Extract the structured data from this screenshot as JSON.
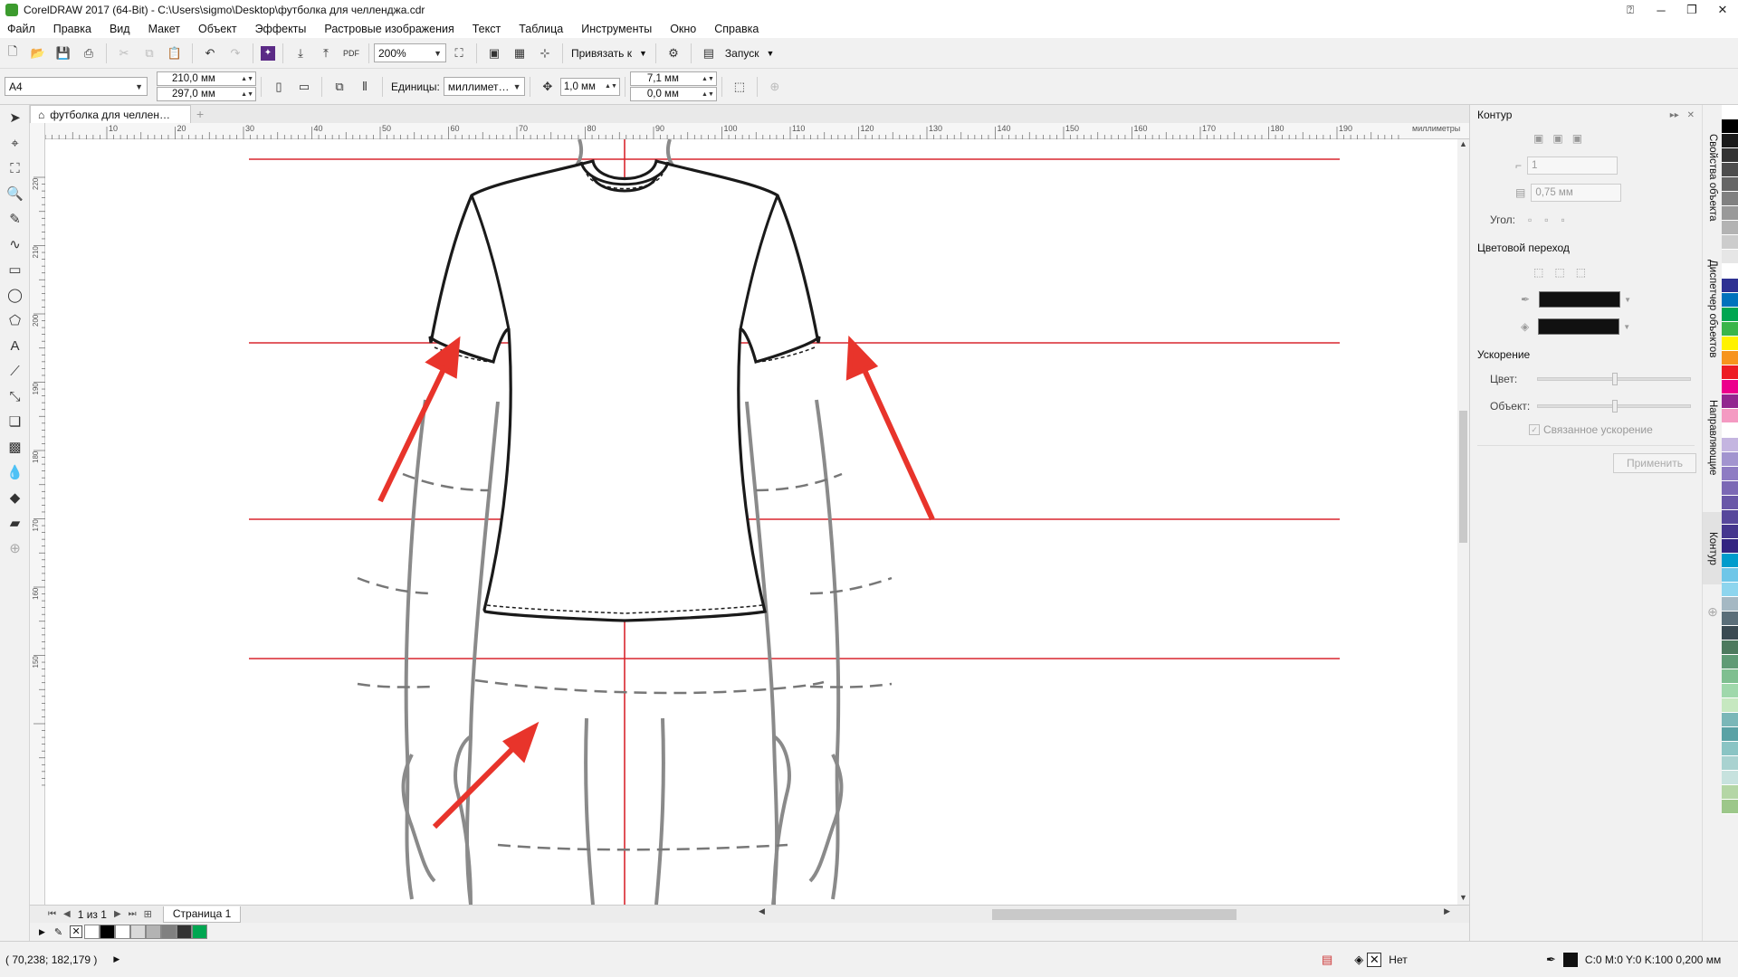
{
  "app": {
    "title": "CorelDRAW 2017 (64-Bit) - C:\\Users\\sigmo\\Desktop\\футболка для челленджа.cdr",
    "accent": "#3c9b2e"
  },
  "menu": [
    "Файл",
    "Правка",
    "Вид",
    "Макет",
    "Объект",
    "Эффекты",
    "Растровые изображения",
    "Текст",
    "Таблица",
    "Инструменты",
    "Окно",
    "Справка"
  ],
  "toolbar": {
    "zoom": "200%",
    "snap_label": "Привязать к",
    "launch_label": "Запуск",
    "pdf_label": "PDF"
  },
  "propbar": {
    "page_size": "A4",
    "width": "210,0 мм",
    "height": "297,0 мм",
    "units_label": "Единицы:",
    "units_value": "миллимет…",
    "nudge": "1,0 мм",
    "dup_x": "7,1 мм",
    "dup_y": "0,0 мм"
  },
  "doc_tab": "футболка для челлен…",
  "ruler": {
    "unit": "миллиметры",
    "h_ticks": [
      "10",
      "20",
      "30",
      "40",
      "50",
      "60",
      "70",
      "80",
      "90",
      "100",
      "110",
      "120",
      "130",
      "140",
      "150",
      "160",
      "170",
      "180",
      "190"
    ],
    "v_ticks": [
      "220",
      "210",
      "200",
      "190",
      "180",
      "170",
      "160",
      "150"
    ]
  },
  "pages": {
    "counter": "1 из 1",
    "page_tab": "Страница 1"
  },
  "status": {
    "coords": "( 70,238; 182,179 )",
    "fill_label": "Нет",
    "outline_info": "C:0 M:0 Y:0 K:100  0,200 мм"
  },
  "docker": {
    "title": "Контур",
    "outline_width_value": "1",
    "outline_size_value": "0,75 мм",
    "angle_label": "Угол:",
    "blend_header": "Цветовой переход",
    "accel_header": "Ускорение",
    "color_label": "Цвет:",
    "object_label": "Объект:",
    "linked_label": "Связанное ускорение",
    "apply_label": "Применить"
  },
  "side_tabs": [
    "Свойства объекта",
    "Диспетчер объектов",
    "Направляющие",
    "Контур"
  ],
  "palette_colors": [
    "#ffffff",
    "#000000",
    "#1a1a1a",
    "#333333",
    "#4d4d4d",
    "#666666",
    "#808080",
    "#999999",
    "#b3b3b3",
    "#cccccc",
    "#e6e6e6",
    "#ffffff",
    "#2e3192",
    "#0072bc",
    "#00a651",
    "#39b54a",
    "#fff200",
    "#f7941d",
    "#ed1c24",
    "#ec008c",
    "#92278f",
    "#f49ac2",
    "#ffffff",
    "#c4b5e0",
    "#a294cf",
    "#8e7cc3",
    "#7b68b5",
    "#6957a8",
    "#57479b",
    "#45368e",
    "#332581",
    "#009ccc",
    "#6ec6e8",
    "#8dd5ee",
    "#a5b8c3",
    "#5a6e79",
    "#3a4a52",
    "#4d7a5e",
    "#5f9b75",
    "#7fbf90",
    "#9fd8ab",
    "#c6e8c0",
    "#7ab7b8",
    "#5aa2a5",
    "#8ac4c4",
    "#a9d2d0",
    "#c7e2de",
    "#b4d6a5",
    "#9cc78a"
  ],
  "color_well": [
    "#ffffff",
    "#000000",
    "#ffffff",
    "#d9d9d9",
    "#b3b3b3",
    "#808080",
    "#333333",
    "#00a651"
  ]
}
